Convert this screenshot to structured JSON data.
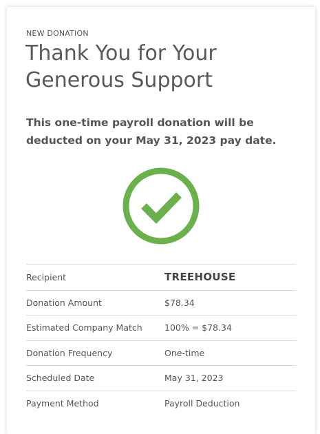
{
  "header": {
    "eyebrow": "NEW DONATION",
    "title": "Thank You for Your Generous Support",
    "subtitle": "This one-time payroll donation will be deducted on your May 31, 2023 pay date."
  },
  "status": {
    "icon": "checkmark-circle-icon",
    "color": "#6ab04c"
  },
  "details": [
    {
      "label": "Recipient",
      "value": "TREEHOUSE"
    },
    {
      "label": "Donation Amount",
      "value": "$78.34"
    },
    {
      "label": "Estimated Company Match",
      "value": "100% = $78.34"
    },
    {
      "label": "Donation Frequency",
      "value": "One-time"
    },
    {
      "label": "Scheduled Date",
      "value": "May 31, 2023"
    },
    {
      "label": "Payment Method",
      "value": "Payroll Deduction"
    }
  ]
}
